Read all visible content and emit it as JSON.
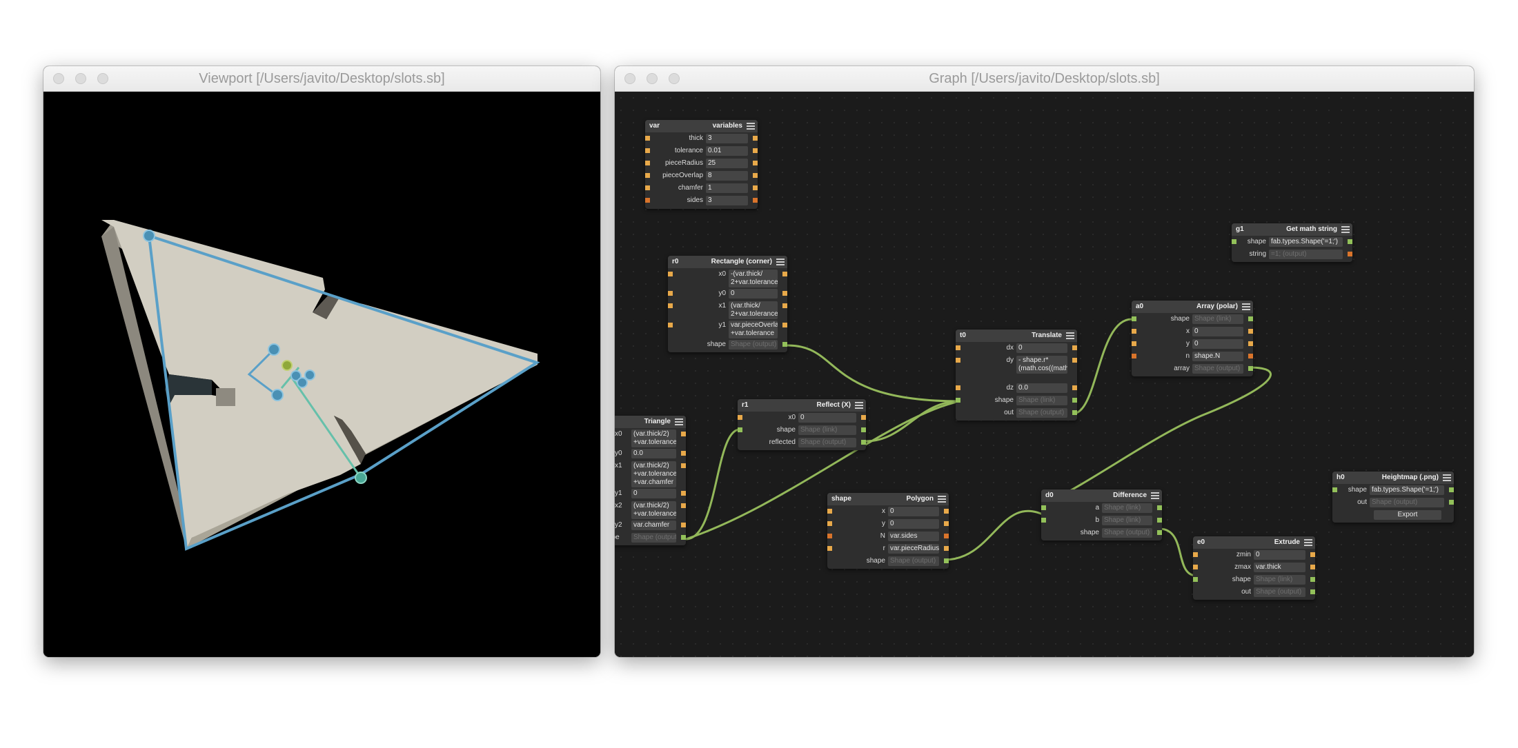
{
  "viewport": {
    "title": "Viewport [/Users/javito/Desktop/slots.sb]"
  },
  "graph": {
    "title": "Graph [/Users/javito/Desktop/slots.sb]"
  },
  "colors": {
    "port_number": "#e8a94a",
    "port_integer": "#d9742b",
    "port_shape": "#93c15a",
    "wire": "#93b85a",
    "outline": "#5aa0c8",
    "handle": "#4a90b4",
    "plate": "#cfcbbf"
  },
  "nodes": {
    "var": {
      "id": "var",
      "type": "variables",
      "rows": [
        {
          "label": "thick",
          "value": "3"
        },
        {
          "label": "tolerance",
          "value": "0.01"
        },
        {
          "label": "pieceRadius",
          "value": "25"
        },
        {
          "label": "pieceOverlap",
          "value": "8"
        },
        {
          "label": "chamfer",
          "value": "1"
        },
        {
          "label": "sides",
          "value": "3"
        }
      ]
    },
    "r0": {
      "id": "r0",
      "type": "Rectangle (corner)",
      "rows": [
        {
          "label": "x0",
          "value": "-(var.thick/ 2+var.tolerance)"
        },
        {
          "label": "y0",
          "value": "0"
        },
        {
          "label": "x1",
          "value": "(var.thick/ 2+var.tolerance)"
        },
        {
          "label": "y1",
          "value": "var.pieceOverlap +var.tolerance"
        },
        {
          "label": "shape",
          "value": "Shape (output)"
        }
      ]
    },
    "triangle": {
      "id": "",
      "type": "Triangle",
      "rows": [
        {
          "label": "x0",
          "value": "(var.thick/2) +var.tolerance"
        },
        {
          "label": "y0",
          "value": "0.0"
        },
        {
          "label": "x1",
          "value": "(var.thick/2) +var.tolerance +var.chamfer"
        },
        {
          "label": "y1",
          "value": "0"
        },
        {
          "label": "x2",
          "value": "(var.thick/2) +var.tolerance"
        },
        {
          "label": "y2",
          "value": "var.chamfer"
        },
        {
          "label": "ape",
          "value": "Shape (output)"
        }
      ]
    },
    "r1": {
      "id": "r1",
      "type": "Reflect (X)",
      "rows": [
        {
          "label": "x0",
          "value": "0"
        },
        {
          "label": "shape",
          "value": "Shape (link)"
        },
        {
          "label": "reflected",
          "value": "Shape (output)"
        }
      ]
    },
    "t0": {
      "id": "t0",
      "type": "Translate",
      "rows": [
        {
          "label": "dx",
          "value": "0"
        },
        {
          "label": "dy",
          "value": "- shape.r*(math.cos((math.pi)/(shape.N))"
        },
        {
          "label": "dz",
          "value": "0.0"
        },
        {
          "label": "shape",
          "value": "Shape (link)"
        },
        {
          "label": "out",
          "value": "Shape (output)"
        }
      ]
    },
    "a0": {
      "id": "a0",
      "type": "Array (polar)",
      "rows": [
        {
          "label": "shape",
          "value": "Shape (link)"
        },
        {
          "label": "x",
          "value": "0"
        },
        {
          "label": "y",
          "value": "0"
        },
        {
          "label": "n",
          "value": "shape.N"
        },
        {
          "label": "array",
          "value": "Shape (output)"
        }
      ]
    },
    "g1": {
      "id": "g1",
      "type": "Get math string",
      "rows": [
        {
          "label": "shape",
          "value": "fab.types.Shape('=1;')"
        },
        {
          "label": "string",
          "value": "=1; (output)"
        }
      ]
    },
    "polygon": {
      "id": "shape",
      "type": "Polygon",
      "rows": [
        {
          "label": "x",
          "value": "0"
        },
        {
          "label": "y",
          "value": "0"
        },
        {
          "label": "N",
          "value": "var.sides"
        },
        {
          "label": "r",
          "value": "var.pieceRadius"
        },
        {
          "label": "shape",
          "value": "Shape (output)"
        }
      ]
    },
    "d0": {
      "id": "d0",
      "type": "Difference",
      "rows": [
        {
          "label": "a",
          "value": "Shape (link)"
        },
        {
          "label": "b",
          "value": "Shape (link)"
        },
        {
          "label": "shape",
          "value": "Shape (output)"
        }
      ]
    },
    "e0": {
      "id": "e0",
      "type": "Extrude",
      "rows": [
        {
          "label": "zmin",
          "value": "0"
        },
        {
          "label": "zmax",
          "value": "var.thick"
        },
        {
          "label": "shape",
          "value": "Shape (link)"
        },
        {
          "label": "out",
          "value": "Shape (output)"
        }
      ]
    },
    "h0": {
      "id": "h0",
      "type": "Heightmap (.png)",
      "rows": [
        {
          "label": "shape",
          "value": "fab.types.Shape('=1;')"
        },
        {
          "label": "out",
          "value": "Shape (output)"
        }
      ],
      "button": "Export"
    }
  }
}
